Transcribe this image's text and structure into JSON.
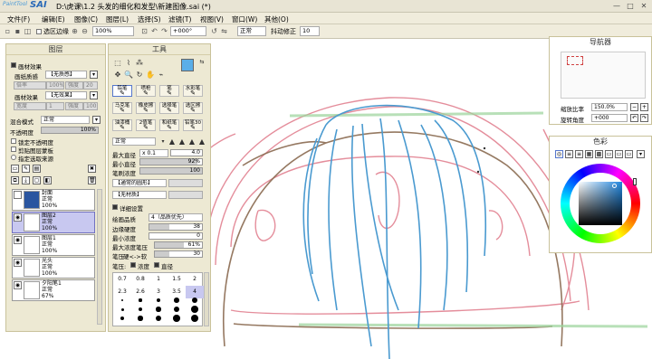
{
  "app": {
    "logo_small": "PaintTool",
    "logo_big": "SAI",
    "title": "D:\\虎课\\1.2 头发的细化和发型\\新建图像.sai (*)"
  },
  "menu": [
    "文件(F)",
    "编辑(E)",
    "图像(C)",
    "图层(L)",
    "选择(S)",
    "滤镜(T)",
    "视图(V)",
    "窗口(W)",
    "其他(O)"
  ],
  "toolbar": {
    "selection_edge": "选区边缘",
    "zoom": "100%",
    "angle": "+000°",
    "mode": "正常",
    "stabilizer_label": "抖动修正",
    "stabilizer": "10"
  },
  "layers_panel": {
    "title": "图层",
    "paper_effect": "画材效果",
    "texture_label": "画纸质感",
    "texture_value": "【无质感】",
    "scale_label": "倍率",
    "scale_value": "100%",
    "strength_label": "强度",
    "strength_value": "20",
    "effect_label": "画材效果",
    "effect_value": "【无效果】",
    "width_label": "宽度",
    "width_value": "1",
    "strength2_value": "100",
    "blend_label": "混合模式",
    "blend_value": "正常",
    "opacity_label": "不透明度",
    "opacity_value": "100%",
    "opacity_fraction": 1.0,
    "lock_opacity": "锁定不透明度",
    "clip_group": "剪贴图层蒙板",
    "specify_source": "指定选取来源",
    "layers": [
      {
        "name": "封面",
        "mode": "正常",
        "opacity": "100%",
        "selected": false
      },
      {
        "name": "图层2",
        "mode": "正常",
        "opacity": "100%",
        "selected": true
      },
      {
        "name": "图层1",
        "mode": "正常",
        "opacity": "100%",
        "selected": false
      },
      {
        "name": "光头",
        "mode": "正常",
        "opacity": "100%",
        "selected": false
      },
      {
        "name": "夕阳笔1",
        "mode": "正常",
        "opacity": "67%",
        "selected": false
      }
    ]
  },
  "tools_panel": {
    "title": "工具",
    "brushes": [
      {
        "label": "铅笔",
        "selected": true
      },
      {
        "label": "喷枪",
        "selected": false
      },
      {
        "label": "笔",
        "selected": false
      },
      {
        "label": "水彩笔",
        "selected": false
      },
      {
        "label": "马克笔",
        "selected": false
      },
      {
        "label": "橡皮擦",
        "selected": false
      },
      {
        "label": "选择笔",
        "selected": false
      },
      {
        "label": "选区擦",
        "selected": false
      },
      {
        "label": "油漆桶",
        "selected": false
      },
      {
        "label": "2值笔",
        "selected": false
      },
      {
        "label": "和纸笔",
        "selected": false
      },
      {
        "label": "铅笔30",
        "selected": false
      }
    ],
    "blend_value": "正常",
    "max_size_label": "最大直径",
    "max_size_mult": "x 0.1",
    "max_size_value": "4.0",
    "min_size_label": "最小直径",
    "min_size_value": "92%",
    "min_size_fraction": 0.92,
    "density_label": "笔刷浓度",
    "density_value": "100",
    "density_fraction": 1.0,
    "shape_value": "【通常的圆形】",
    "material_value": "【无材质】",
    "detail_label": "详细设置",
    "quality_label": "绘画品质",
    "quality_value": "4（品质优先）",
    "edge_label": "边缘硬度",
    "edge_value": "38",
    "edge_fraction": 0.38,
    "min_density_label": "最小浓度",
    "min_density_value": "0",
    "min_density_fraction": 0.0,
    "max_pressure_label": "最大浓度笔压",
    "max_pressure_value": "61%",
    "max_pressure_fraction": 0.61,
    "pressure_label": "笔压",
    "pressure_hard": "硬<->软",
    "pressure_value": "30",
    "pressure_fraction": 0.3,
    "pressure2_label": "笔压:",
    "pressure_density": "浓度",
    "pressure_size": "直径",
    "sizes": [
      "0.7",
      "0.8",
      "1",
      "1.5",
      "2",
      "2.3",
      "2.6",
      "3",
      "3.5",
      "4"
    ]
  },
  "navigator": {
    "title": "导航器",
    "zoom_label": "缩放比率",
    "zoom_value": "150.0%",
    "angle_label": "旋转角度",
    "angle_value": "+000"
  },
  "color_panel": {
    "title": "色彩"
  }
}
